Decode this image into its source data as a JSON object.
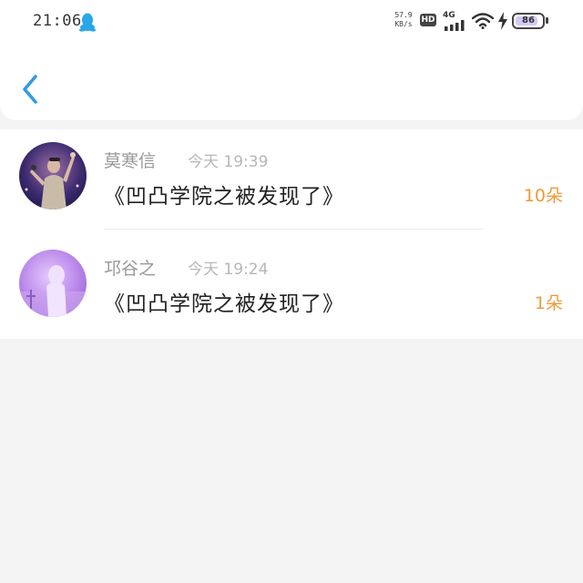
{
  "status_bar": {
    "time": "21:06",
    "net_speed_value": "57.9",
    "net_speed_unit": "KB/s",
    "hd_label": "HD",
    "network_label": "4G",
    "battery": "86",
    "icons": [
      "qq-penguin-icon",
      "hd-icon",
      "signal-4g-icon",
      "wifi-icon",
      "charging-bolt-icon",
      "battery-icon"
    ]
  },
  "header": {
    "back_icon": "chevron-left-icon",
    "accent_color": "#2f9be6"
  },
  "messages": [
    {
      "name": "莫寒信",
      "time": "今天 19:39",
      "text": "《凹凸学院之被发现了》",
      "count": "10朵"
    },
    {
      "name": "邛谷之",
      "time": "今天 19:24",
      "text": "《凹凸学院之被发现了》",
      "count": "1朵"
    }
  ],
  "colors": {
    "count": "#f19a3a",
    "name": "#9a9a9a",
    "time": "#b7b7b7",
    "page_bg": "#f4f4f4"
  }
}
